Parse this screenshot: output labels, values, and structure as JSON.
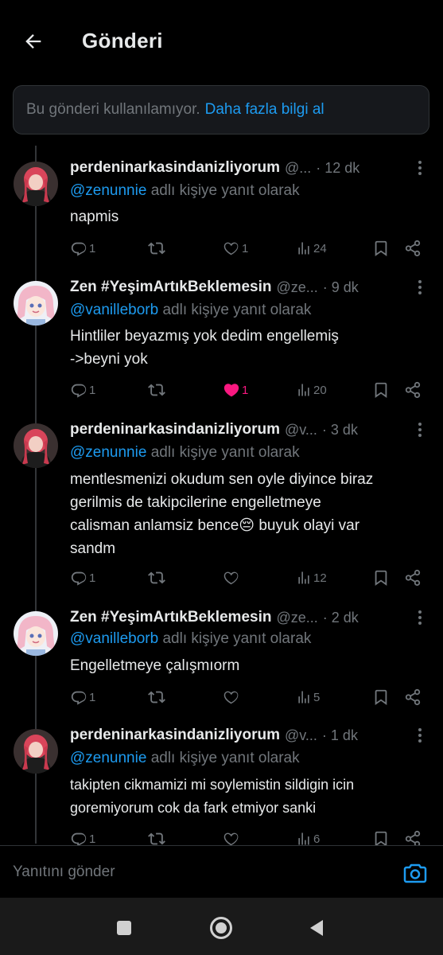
{
  "header": {
    "title": "Gönderi"
  },
  "notice": {
    "text": "Bu gönderi kullanılamıyor.",
    "link": "Daha fazla bilgi al"
  },
  "tweets": [
    {
      "name": "perdeninarkasindanizliyorum",
      "handle": "@...",
      "time": "· 12 dk",
      "reply_to": "@zenunnie",
      "reply_suffix": " adlı kişiye yanıt olarak",
      "lines": [
        "napmis"
      ],
      "replies": "1",
      "retweets": "",
      "likes": "1",
      "views": "24",
      "liked": false
    },
    {
      "name": "Zen #YeşimArtıkBeklemesin",
      "handle": "@ze...",
      "time": "· 9 dk",
      "reply_to": "@vanilleborb",
      "reply_suffix": " adlı kişiye yanıt olarak",
      "lines": [
        "Hintliler beyazmış yok dedim engellemiş",
        "->beyni yok"
      ],
      "replies": "1",
      "retweets": "",
      "likes": "1",
      "views": "20",
      "liked": true
    },
    {
      "name": "perdeninarkasindanizliyorum",
      "handle": "@v...",
      "time": "· 3 dk",
      "reply_to": "@zenunnie",
      "reply_suffix": " adlı kişiye yanıt olarak",
      "lines": [
        "mentlesmenizi okudum sen oyle diyince biraz",
        "gerilmis de takipcilerine engelletmeye",
        "calisman anlamsiz bence😔 buyuk olayi var",
        "sandm"
      ],
      "replies": "1",
      "retweets": "",
      "likes": "",
      "views": "12",
      "liked": false
    },
    {
      "name": "Zen #YeşimArtıkBeklemesin",
      "handle": "@ze...",
      "time": "· 2 dk",
      "reply_to": "@vanilleborb",
      "reply_suffix": " adlı kişiye yanıt olarak",
      "lines": [
        "Engelletmeye çalışmıorm"
      ],
      "replies": "1",
      "retweets": "",
      "likes": "",
      "views": "5",
      "liked": false
    },
    {
      "name": "perdeninarkasindanizliyorum",
      "handle": "@v...",
      "time": "· 1 dk",
      "reply_to": "@zenunnie",
      "reply_suffix": " adlı kişiye yanıt olarak",
      "lines": [
        "takipten cikmamizi mi soylemistin sildigin icin",
        "goremiyorum cok da fark etmiyor sanki"
      ],
      "replies": "1",
      "retweets": "",
      "likes": "",
      "views": "6",
      "liked": false
    }
  ],
  "reply_bar": {
    "placeholder": "Yanıtını gönder"
  },
  "colors": {
    "background": "#000000",
    "accent": "#1d9bf0",
    "like": "#f91880",
    "muted": "#71767b"
  }
}
